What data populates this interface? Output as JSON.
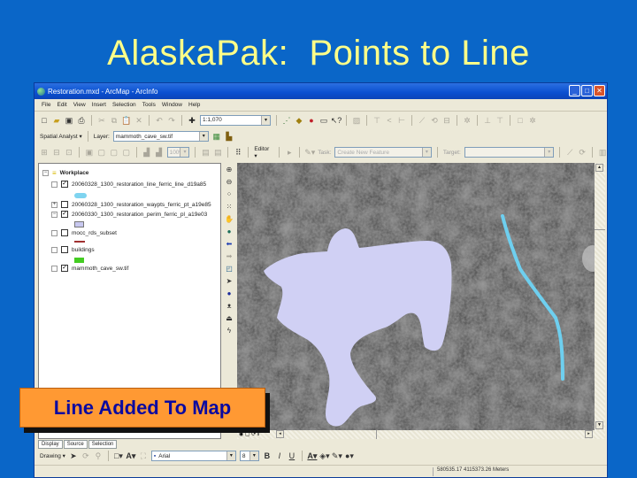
{
  "slide": {
    "title": "AlaskaPak:  Points to Line",
    "caption": "Line Added To Map",
    "colors": {
      "background": "#0a66c8",
      "title": "#ffff88",
      "caption_bg": "#ff9933",
      "caption_text": "#0a0aa0"
    }
  },
  "window": {
    "title": "Restoration.mxd - ArcMap - ArcInfo",
    "controls": {
      "minimize": "_",
      "maximize": "□",
      "close": "✕"
    }
  },
  "menu": [
    "File",
    "Edit",
    "View",
    "Insert",
    "Selection",
    "Tools",
    "Window",
    "Help"
  ],
  "standard_toolbar": {
    "scale_value": "1:1,070"
  },
  "spatial_analyst": {
    "menu_label": "Spatial Analyst ▾",
    "layer_label": "Layer:",
    "layer_value": "mammoth_cave_sw.tif"
  },
  "georef_toolbar": {
    "zoom_value": "100%"
  },
  "editor_toolbar": {
    "editor_label": "Editor ▾",
    "task_label": "Task:",
    "task_value": "Create New Feature",
    "target_label": "Target:",
    "target_value": ""
  },
  "toc": {
    "root": "Workplace",
    "layers": [
      {
        "name": "20060328_1300_restoration_line_ferric_line_d19a85",
        "checked": true,
        "expanded": true,
        "swatch": "#7fd4f0",
        "swatch_type": "line-thick"
      },
      {
        "name": "20060328_1300_restoration_waypts_ferric_pt_a19e85",
        "checked": false,
        "expanded": false,
        "swatch": null
      },
      {
        "name": "20060330_1300_restoration_perim_ferric_pl_a19e03",
        "checked": true,
        "expanded": true,
        "swatch": "#c8c8f0",
        "swatch_type": "polygon"
      },
      {
        "name": "mocc_rds_subset",
        "checked": false,
        "expanded": true,
        "swatch": "#a03030",
        "swatch_type": "line"
      },
      {
        "name": "buildings",
        "checked": false,
        "expanded": true,
        "swatch": "#44cc22",
        "swatch_type": "polygon"
      },
      {
        "name": "mammoth_cave_sw.tif",
        "checked": true,
        "expanded": false,
        "swatch": null
      }
    ],
    "tabs": [
      "Display",
      "Source",
      "Selection"
    ]
  },
  "map": {
    "polygon_color": "#d0d0f4",
    "line_color": "#6ecfef",
    "background": "#585858"
  },
  "drawing_toolbar": {
    "drawing_label": "Drawing ▾",
    "font_value": "Arial",
    "font_size": "8",
    "bold": "B",
    "italic": "I",
    "underline": "U"
  },
  "status": {
    "coordinates": "580535.17  4115373.26 Meters"
  }
}
